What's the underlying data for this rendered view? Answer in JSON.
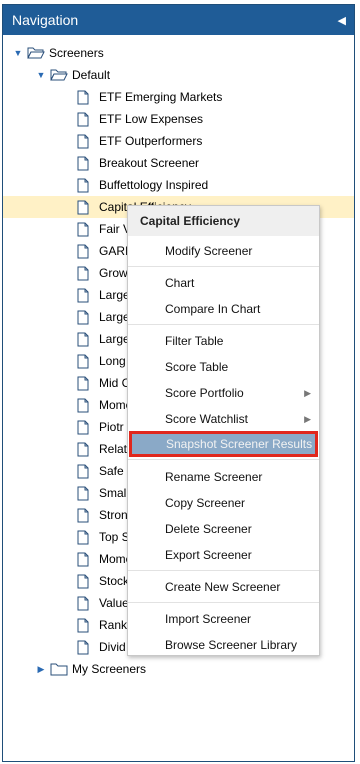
{
  "panel": {
    "title": "Navigation",
    "collapse_icon": "chevron-left-icon"
  },
  "tree": {
    "root": {
      "label": "Screeners",
      "icon": "folder-open-icon"
    },
    "default_folder": {
      "label": "Default",
      "icon": "folder-open-icon"
    },
    "items": [
      "ETF Emerging Markets",
      "ETF Low Expenses",
      "ETF Outperformers",
      "Breakout Screener",
      "Buffettology Inspired",
      "Capital Efficiency",
      "Fair V",
      "GARI",
      "Grow",
      "Large",
      "Large",
      "Large",
      "Long",
      "Mid C",
      "Mome",
      "Piotr",
      "Relat",
      "Safe",
      "Smal",
      "Stron",
      "Top S",
      "Mome",
      "Stock",
      "Value",
      "Rank",
      "Divid"
    ],
    "my_screeners": {
      "label": "My Screeners",
      "icon": "folder-closed-icon"
    }
  },
  "context_menu": {
    "title": "Capital Efficiency",
    "items": [
      "Modify Screener",
      "Chart",
      "Compare In Chart",
      "Filter Table",
      "Score Table",
      "Score Portfolio",
      "Score Watchlist",
      "Snapshot Screener Results",
      "Rename Screener",
      "Copy Screener",
      "Delete Screener",
      "Export Screener",
      "Create New Screener",
      "Import Screener",
      "Browse Screener Library"
    ],
    "highlighted": "Snapshot Screener Results",
    "highlight_color": "#e0271d"
  }
}
